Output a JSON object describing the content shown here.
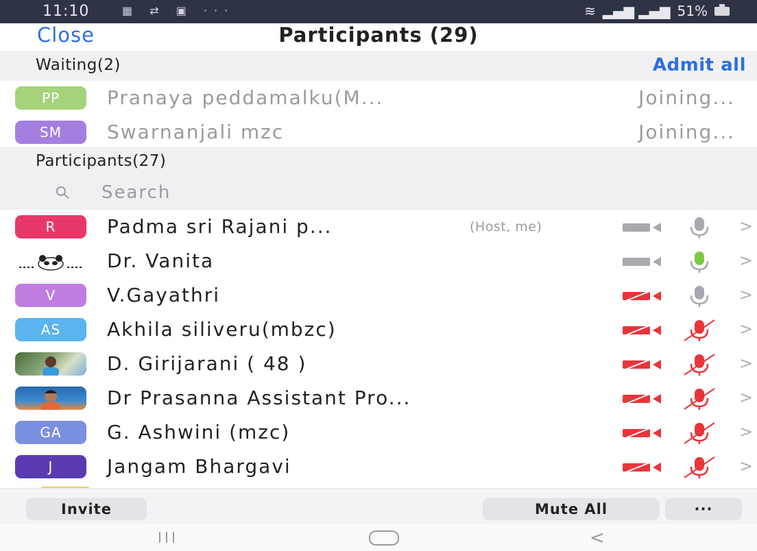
{
  "status_bar": {
    "time": "11:10",
    "notif_icons": [
      "network-badge-icon",
      "sync-icon",
      "gallery-icon",
      "more-icon"
    ],
    "battery": "51%"
  },
  "header": {
    "close_label": "Close",
    "title": "Participants (29)"
  },
  "waiting": {
    "label": "Waiting(2)",
    "admit_all_label": "Admit all",
    "items": [
      {
        "initials": "PP",
        "name": "Pranaya peddamalku(M...",
        "status": "Joining...",
        "color": "#a6d37a"
      },
      {
        "initials": "SM",
        "name": "Swarnanjali mzc",
        "status": "Joining...",
        "color": "#a57fe0"
      }
    ]
  },
  "participants": {
    "label": "Participants(27)",
    "search_placeholder": "Search",
    "items": [
      {
        "initials": "R",
        "name": "Padma sri Rajani p...",
        "tag": "(Host, me)",
        "color": "#e8386a",
        "video": "off-gray",
        "audio": "gray"
      },
      {
        "initials": "",
        "name": "Dr. Vanita",
        "tag": "",
        "color": "#ffffff",
        "video": "off-gray",
        "audio": "green",
        "avatar_image": "panda"
      },
      {
        "initials": "V",
        "name": "V.Gayathri",
        "tag": "",
        "color": "#c07de0",
        "video": "off-red",
        "audio": "gray"
      },
      {
        "initials": "AS",
        "name": "Akhila siliveru(mbzc)",
        "tag": "",
        "color": "#5ab4f0",
        "video": "off-red",
        "audio": "muted-red"
      },
      {
        "initials": "",
        "name": "D. Girijarani ( 48 )",
        "tag": "",
        "color": "#6a8a5a",
        "video": "off-red",
        "audio": "muted-red",
        "avatar_image": "photo"
      },
      {
        "initials": "",
        "name": "Dr Prasanna Assistant Pro...",
        "tag": "",
        "color": "#3a7ac0",
        "video": "off-red",
        "audio": "muted-red",
        "avatar_image": "photo"
      },
      {
        "initials": "GA",
        "name": "G. Ashwini (mzc)",
        "tag": "",
        "color": "#7a8fe0",
        "video": "off-red",
        "audio": "muted-red"
      },
      {
        "initials": "J",
        "name": "Jangam Bhargavi",
        "tag": "",
        "color": "#5a3ab0",
        "video": "off-red",
        "audio": "muted-red"
      }
    ]
  },
  "bottom_bar": {
    "invite_label": "Invite",
    "mute_all_label": "Mute All",
    "more_label": "···"
  },
  "colors": {
    "accent": "#2d6fe0",
    "muted_red": "#e8353a",
    "mic_green": "#7ac943",
    "icon_gray": "#a8a8ae"
  }
}
